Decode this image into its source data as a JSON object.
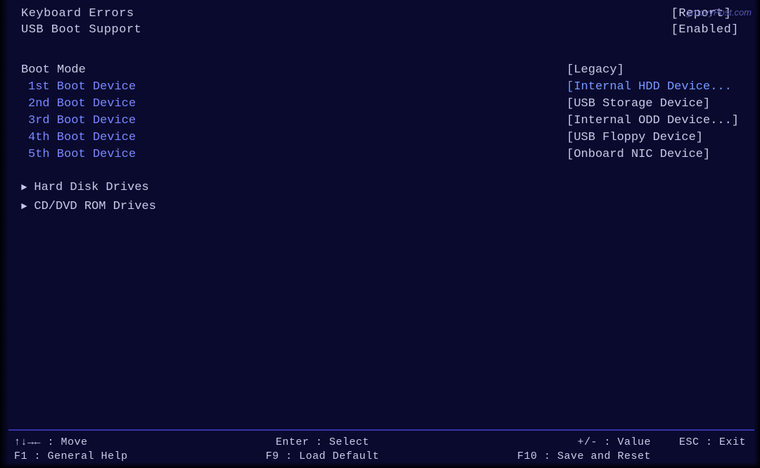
{
  "watermark": "groovyPost.com",
  "top_section": {
    "labels": [
      "Keyboard Errors",
      "USB Boot Support"
    ],
    "values": [
      "[Report]",
      "[Enabled]"
    ]
  },
  "boot_mode": {
    "label": "Boot Mode",
    "value": "[Legacy]"
  },
  "boot_devices": [
    {
      "label": "1st Boot Device",
      "value": "[Internal HDD Device..."
    },
    {
      "label": "2nd Boot Device",
      "value": "[USB Storage Device]"
    },
    {
      "label": "3rd Boot Device",
      "value": "[Internal ODD Device...]"
    },
    {
      "label": "4th Boot Device",
      "value": "[USB Floppy Device]"
    },
    {
      "label": "5th Boot Device",
      "value": "[Onboard NIC Device]"
    }
  ],
  "drives": [
    "Hard Disk Drives",
    "CD/DVD ROM Drives"
  ],
  "status_bar": {
    "left": [
      "↑↓→← : Move",
      "F1 : General Help"
    ],
    "center": [
      "Enter : Select",
      "F9 : Load Default"
    ],
    "right_left": [
      "+/- : Value",
      "F10 : Save and Reset"
    ],
    "right_right": [
      "ESC : Exit",
      ""
    ]
  }
}
